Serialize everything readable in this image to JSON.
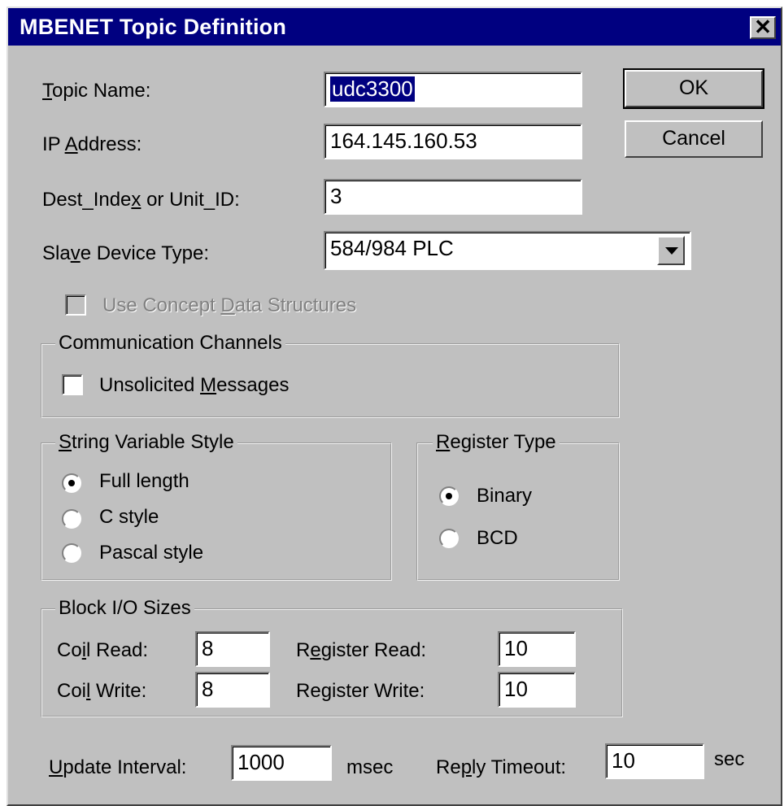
{
  "dialog": {
    "title": "MBENET Topic Definition",
    "close_label": "✕"
  },
  "fields": {
    "topic_name": {
      "label_pre": "",
      "label_accel": "T",
      "label_post": "opic Name:",
      "value": "udc3300"
    },
    "ip_address": {
      "label_pre": "IP ",
      "label_accel": "A",
      "label_post": "ddress:",
      "value": "164.145.160.53"
    },
    "dest_index": {
      "label_pre": "Dest_Inde",
      "label_accel": "x",
      "label_post": " or Unit_ID:",
      "value": "3"
    },
    "slave_device_type": {
      "label_pre": "Sla",
      "label_accel": "v",
      "label_post": "e Device Type:",
      "value": "584/984 PLC"
    }
  },
  "buttons": {
    "ok": "OK",
    "cancel": "Cancel"
  },
  "concept": {
    "label_pre": "Use Concept ",
    "label_accel": "D",
    "label_post": "ata Structures",
    "checked": false,
    "enabled": false
  },
  "comm_channels": {
    "title": "Communication Channels",
    "unsolicited": {
      "label_pre": "Unsolicited ",
      "label_accel": "M",
      "label_post": "essages",
      "checked": false
    }
  },
  "string_style": {
    "title_accel": "S",
    "title_post": "tring Variable Style",
    "options": [
      "Full length",
      "C style",
      "Pascal style"
    ],
    "selected": "Full length"
  },
  "register_type": {
    "title_accel": "R",
    "title_post": "egister Type",
    "options": [
      "Binary",
      "BCD"
    ],
    "selected": "Binary"
  },
  "block_io": {
    "title": "Block I/O Sizes",
    "coil_read": {
      "label_pre": "Co",
      "label_accel": "i",
      "label_post": "l Read:",
      "value": "8"
    },
    "coil_write": {
      "label_pre": "Coi",
      "label_accel": "l",
      "label_post": " Write:",
      "value": "8"
    },
    "register_read": {
      "label_pre": "R",
      "label_accel": "e",
      "label_post": "gister Read:",
      "value": "10"
    },
    "register_write": {
      "label_pre": "Re",
      "label_accel": "g",
      "label_post": "ister Write:",
      "value": "10"
    }
  },
  "timing": {
    "update_interval": {
      "label_accel": "U",
      "label_post": "pdate Interval:",
      "value": "1000",
      "unit": "msec"
    },
    "reply_timeout": {
      "label_pre": "Re",
      "label_accel": "p",
      "label_post": "ly Timeout:",
      "value": "10",
      "unit": "sec"
    }
  }
}
